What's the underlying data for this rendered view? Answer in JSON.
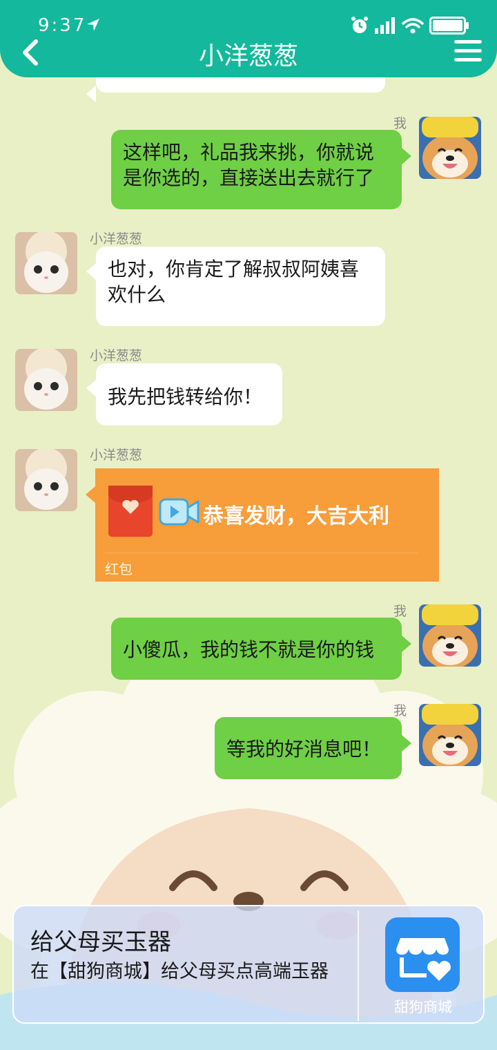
{
  "status_bar": {
    "time": "9:37"
  },
  "header": {
    "title": "小洋葱葱"
  },
  "messages": [
    {
      "sender": "我",
      "text_lines": [
        "这样吧，礼品我来挑，你就说",
        "是你选的，直接送出去就行了"
      ]
    },
    {
      "sender": "小洋葱葱",
      "text_lines": [
        "也对，你肯定了解叔叔阿姨喜",
        "欢什么"
      ]
    },
    {
      "sender": "小洋葱葱",
      "text": "我先把钱转给你！"
    },
    {
      "sender": "小洋葱葱",
      "red_packet": {
        "greeting": "恭喜发财，大吉大利",
        "label": "红包"
      }
    },
    {
      "sender": "我",
      "text": "小傻瓜，我的钱不就是你的钱"
    },
    {
      "sender": "我",
      "text": "等我的好消息吧！"
    }
  ],
  "promo": {
    "title": "给父母买玉器",
    "description": "在【甜狗商城】给父母买点高端玉器",
    "app_name": "甜狗商城"
  },
  "icons": {
    "back": "chevron-left-icon",
    "menu": "hamburger-menu-icon",
    "alarm": "alarm-icon",
    "signal": "signal-icon",
    "wifi": "wifi-icon",
    "battery": "battery-icon",
    "location": "location-arrow-icon",
    "video": "video-camera-icon",
    "store": "store-heart-icon"
  },
  "colors": {
    "header": "#14b89c",
    "background": "#e9f0c6",
    "my_bubble": "#6fcf45",
    "their_bubble": "#ffffff",
    "red_packet": "#f79d3a",
    "app_icon": "#2b8ff0"
  }
}
